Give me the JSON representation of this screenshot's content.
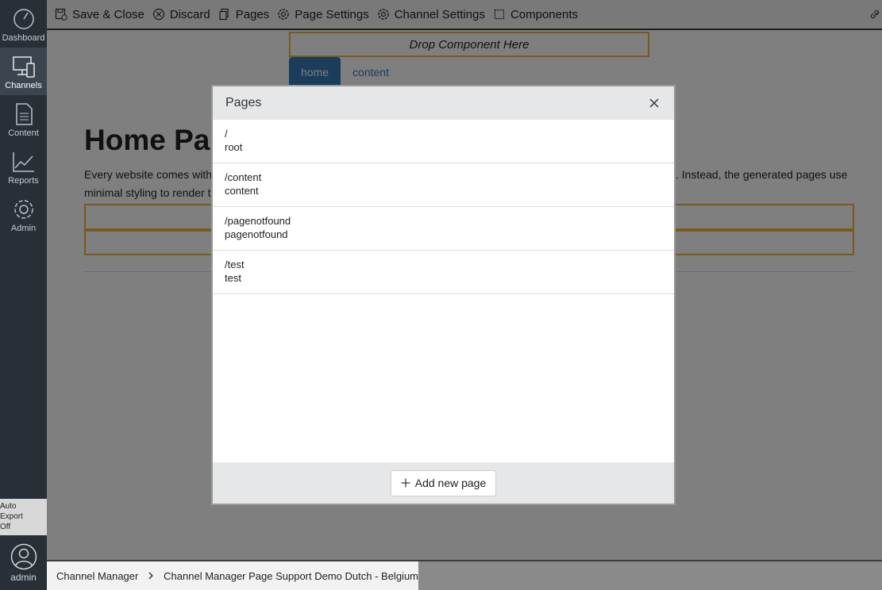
{
  "leftnav": {
    "items": [
      {
        "label": "Dashboard"
      },
      {
        "label": "Channels"
      },
      {
        "label": "Content"
      },
      {
        "label": "Reports"
      },
      {
        "label": "Admin"
      }
    ],
    "auto_export": [
      "Auto",
      "Export",
      "Off"
    ],
    "user": "admin"
  },
  "toolbar": {
    "save_close": "Save & Close",
    "discard": "Discard",
    "pages": "Pages",
    "page_settings": "Page Settings",
    "channel_settings": "Channel Settings",
    "components": "Components"
  },
  "preview": {
    "drop_zone": "Drop Component Here",
    "tabs": [
      {
        "label": "home"
      },
      {
        "label": "content"
      }
    ],
    "title": "Home Pag",
    "text_left_1": "Every website comes with",
    "text_right_1": ". Instead, the generated pages use",
    "text_left_2": "minimal styling to render t"
  },
  "modal": {
    "title": "Pages",
    "pages": [
      {
        "path": "/",
        "name": "root"
      },
      {
        "path": "/content",
        "name": "content"
      },
      {
        "path": "/pagenotfound",
        "name": "pagenotfound"
      },
      {
        "path": "/test",
        "name": "test"
      }
    ],
    "add_button": "Add new page"
  },
  "breadcrumb": {
    "items": [
      "Channel Manager",
      "Channel Manager Page Support Demo Dutch - Belgium"
    ]
  }
}
